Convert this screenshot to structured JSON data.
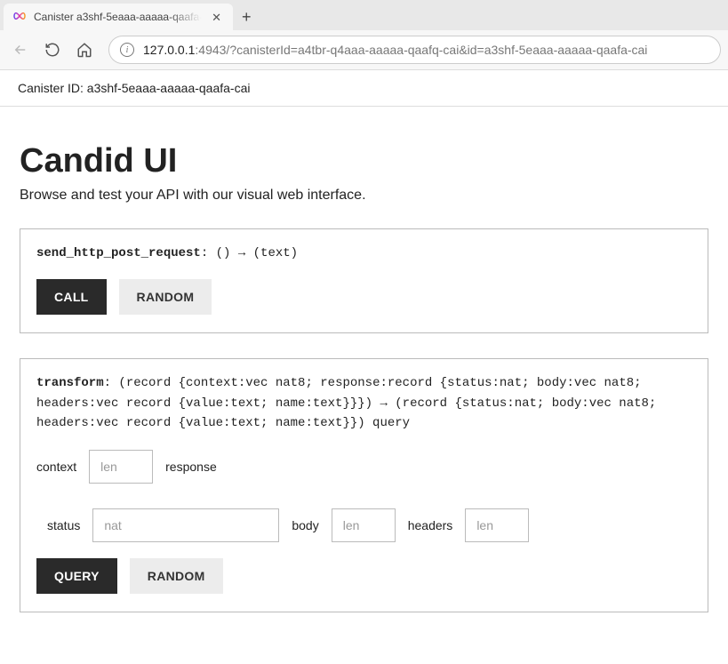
{
  "browser": {
    "tab_title": "Canister a3shf-5eaaa-aaaaa-qaafa-cai",
    "url_host": "127.0.0.1",
    "url_rest": ":4943/?canisterId=a4tbr-q4aaa-aaaaa-qaafq-cai&id=a3shf-5eaaa-aaaaa-qaafa-cai"
  },
  "page": {
    "canister_id_label": "Canister ID: a3shf-5eaaa-aaaaa-qaafa-cai",
    "title": "Candid UI",
    "subtitle": "Browse and test your API with our visual web interface."
  },
  "method1": {
    "name": "send_http_post_request",
    "sig_rest": ": () → (text)",
    "call_btn": "CALL",
    "random_btn": "RANDOM"
  },
  "method2": {
    "name": "transform",
    "sig_rest": ": (record {context:vec nat8; response:record {status:nat; body:vec nat8; headers:vec record {value:text; name:text}}}) → (record {status:nat; body:vec nat8; headers:vec record {value:text; name:text}}) query",
    "context_label": "context",
    "context_placeholder": "len",
    "response_label": "response",
    "status_label": "status",
    "status_placeholder": "nat",
    "body_label": "body",
    "body_placeholder": "len",
    "headers_label": "headers",
    "headers_placeholder": "len",
    "query_btn": "QUERY",
    "random_btn": "RANDOM"
  }
}
